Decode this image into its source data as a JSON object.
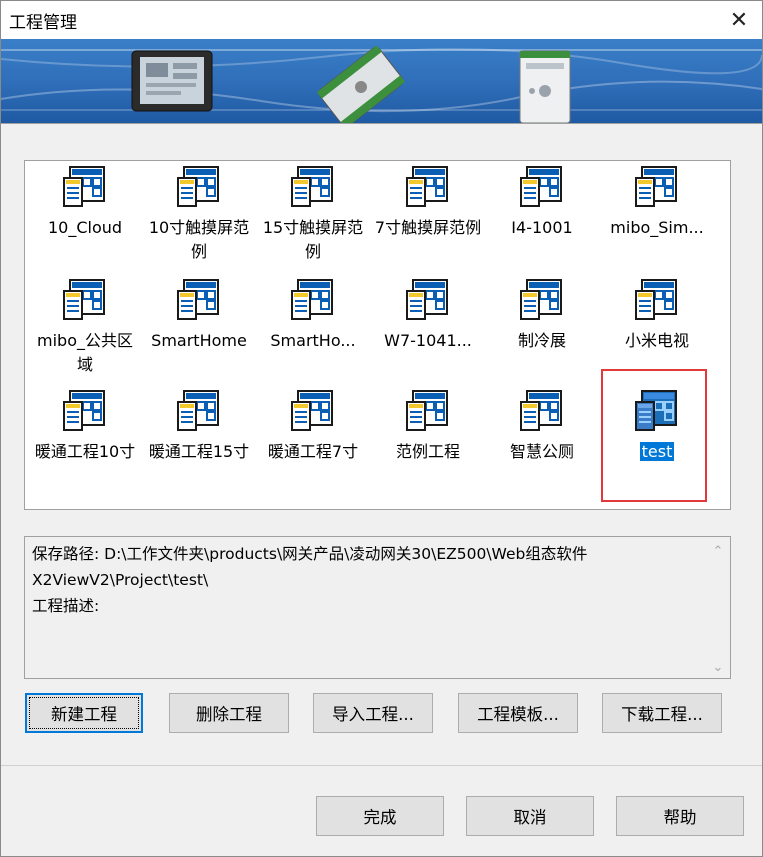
{
  "window": {
    "title": "工程管理",
    "close_glyph": "✕"
  },
  "projects": [
    {
      "label": "10_Cloud",
      "selected": false
    },
    {
      "label": "10寸触摸屏范例",
      "selected": false
    },
    {
      "label": "15寸触摸屏范例",
      "selected": false
    },
    {
      "label": "7寸触摸屏范例",
      "selected": false
    },
    {
      "label": "I4-1001",
      "selected": false
    },
    {
      "label": "mibo_Sim...",
      "selected": false
    },
    {
      "label": "mibo_公共区域",
      "selected": false
    },
    {
      "label": "SmartHome",
      "selected": false
    },
    {
      "label": "SmartHo...",
      "selected": false
    },
    {
      "label": "W7-1041...",
      "selected": false
    },
    {
      "label": "制冷展",
      "selected": false
    },
    {
      "label": "小米电视",
      "selected": false
    },
    {
      "label": "暖通工程10寸",
      "selected": false
    },
    {
      "label": "暖通工程15寸",
      "selected": false
    },
    {
      "label": "暖通工程7寸",
      "selected": false
    },
    {
      "label": "范例工程",
      "selected": false
    },
    {
      "label": "智慧公厕",
      "selected": false
    },
    {
      "label": "test",
      "selected": true
    }
  ],
  "info": {
    "path_line1": "保存路径: D:\\工作文件夹\\products\\网关产品\\凌动网关30\\EZ500\\Web组态软件",
    "path_line2": "X2ViewV2\\Project\\test\\",
    "desc_label": "工程描述:"
  },
  "actions": {
    "new": "新建工程",
    "delete": "删除工程",
    "import": "导入工程...",
    "template": "工程模板...",
    "download": "下载工程..."
  },
  "footer": {
    "finish": "完成",
    "cancel": "取消",
    "help": "帮助"
  },
  "icons": {
    "project": "project-file-icon",
    "close": "close-icon",
    "scroll_up": "scroll-up-icon",
    "scroll_down": "scroll-down-icon"
  },
  "colors": {
    "selection": "#0078d7",
    "highlight_frame": "#e23a3a",
    "banner": "#2f6db8"
  }
}
